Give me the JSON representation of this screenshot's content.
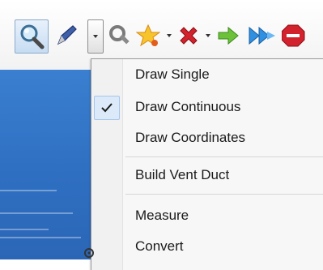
{
  "toolbar": {
    "buttons": [
      {
        "name": "zoom-button",
        "icon": "magnifier-icon"
      },
      {
        "name": "draw-button",
        "icon": "pencil-icon"
      },
      {
        "name": "draw-dropdown-button",
        "icon": "chevron-down-icon"
      },
      {
        "name": "tools-button",
        "icon": "wrench-icon"
      },
      {
        "name": "star-button",
        "icon": "star-icon"
      },
      {
        "name": "delete-button",
        "icon": "red-x-icon"
      },
      {
        "name": "next-button",
        "icon": "green-arrow-icon"
      },
      {
        "name": "fast-forward-button",
        "icon": "blue-double-arrow-icon"
      },
      {
        "name": "stop-button",
        "icon": "stop-icon"
      }
    ]
  },
  "menu": {
    "items": [
      {
        "label": "Draw Single",
        "checked": false
      },
      {
        "label": "Draw Continuous",
        "checked": true
      },
      {
        "label": "Draw Coordinates",
        "checked": false
      },
      {
        "label": "Build Vent Duct",
        "checked": false
      },
      {
        "label": "Measure",
        "checked": false
      },
      {
        "label": "Convert",
        "checked": false
      }
    ]
  },
  "colors": {
    "menu_background": "#f7f7f7",
    "check_highlight": "#dbe9f8",
    "pane_blue": "#2f6fc2"
  }
}
